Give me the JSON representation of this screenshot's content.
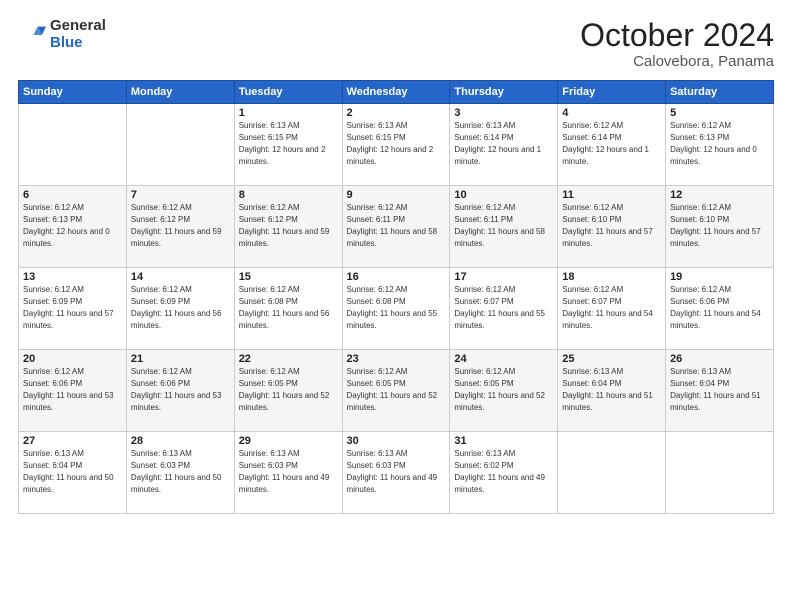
{
  "header": {
    "logo_general": "General",
    "logo_blue": "Blue",
    "month": "October 2024",
    "location": "Calovebora, Panama"
  },
  "weekdays": [
    "Sunday",
    "Monday",
    "Tuesday",
    "Wednesday",
    "Thursday",
    "Friday",
    "Saturday"
  ],
  "weeks": [
    [
      null,
      null,
      {
        "day": 1,
        "sunrise": "6:13 AM",
        "sunset": "6:15 PM",
        "daylight": "12 hours and 2 minutes."
      },
      {
        "day": 2,
        "sunrise": "6:13 AM",
        "sunset": "6:15 PM",
        "daylight": "12 hours and 2 minutes."
      },
      {
        "day": 3,
        "sunrise": "6:13 AM",
        "sunset": "6:14 PM",
        "daylight": "12 hours and 1 minute."
      },
      {
        "day": 4,
        "sunrise": "6:12 AM",
        "sunset": "6:14 PM",
        "daylight": "12 hours and 1 minute."
      },
      {
        "day": 5,
        "sunrise": "6:12 AM",
        "sunset": "6:13 PM",
        "daylight": "12 hours and 0 minutes."
      }
    ],
    [
      {
        "day": 6,
        "sunrise": "6:12 AM",
        "sunset": "6:13 PM",
        "daylight": "12 hours and 0 minutes."
      },
      {
        "day": 7,
        "sunrise": "6:12 AM",
        "sunset": "6:12 PM",
        "daylight": "11 hours and 59 minutes."
      },
      {
        "day": 8,
        "sunrise": "6:12 AM",
        "sunset": "6:12 PM",
        "daylight": "11 hours and 59 minutes."
      },
      {
        "day": 9,
        "sunrise": "6:12 AM",
        "sunset": "6:11 PM",
        "daylight": "11 hours and 58 minutes."
      },
      {
        "day": 10,
        "sunrise": "6:12 AM",
        "sunset": "6:11 PM",
        "daylight": "11 hours and 58 minutes."
      },
      {
        "day": 11,
        "sunrise": "6:12 AM",
        "sunset": "6:10 PM",
        "daylight": "11 hours and 57 minutes."
      },
      {
        "day": 12,
        "sunrise": "6:12 AM",
        "sunset": "6:10 PM",
        "daylight": "11 hours and 57 minutes."
      }
    ],
    [
      {
        "day": 13,
        "sunrise": "6:12 AM",
        "sunset": "6:09 PM",
        "daylight": "11 hours and 57 minutes."
      },
      {
        "day": 14,
        "sunrise": "6:12 AM",
        "sunset": "6:09 PM",
        "daylight": "11 hours and 56 minutes."
      },
      {
        "day": 15,
        "sunrise": "6:12 AM",
        "sunset": "6:08 PM",
        "daylight": "11 hours and 56 minutes."
      },
      {
        "day": 16,
        "sunrise": "6:12 AM",
        "sunset": "6:08 PM",
        "daylight": "11 hours and 55 minutes."
      },
      {
        "day": 17,
        "sunrise": "6:12 AM",
        "sunset": "6:07 PM",
        "daylight": "11 hours and 55 minutes."
      },
      {
        "day": 18,
        "sunrise": "6:12 AM",
        "sunset": "6:07 PM",
        "daylight": "11 hours and 54 minutes."
      },
      {
        "day": 19,
        "sunrise": "6:12 AM",
        "sunset": "6:06 PM",
        "daylight": "11 hours and 54 minutes."
      }
    ],
    [
      {
        "day": 20,
        "sunrise": "6:12 AM",
        "sunset": "6:06 PM",
        "daylight": "11 hours and 53 minutes."
      },
      {
        "day": 21,
        "sunrise": "6:12 AM",
        "sunset": "6:06 PM",
        "daylight": "11 hours and 53 minutes."
      },
      {
        "day": 22,
        "sunrise": "6:12 AM",
        "sunset": "6:05 PM",
        "daylight": "11 hours and 52 minutes."
      },
      {
        "day": 23,
        "sunrise": "6:12 AM",
        "sunset": "6:05 PM",
        "daylight": "11 hours and 52 minutes."
      },
      {
        "day": 24,
        "sunrise": "6:12 AM",
        "sunset": "6:05 PM",
        "daylight": "11 hours and 52 minutes."
      },
      {
        "day": 25,
        "sunrise": "6:13 AM",
        "sunset": "6:04 PM",
        "daylight": "11 hours and 51 minutes."
      },
      {
        "day": 26,
        "sunrise": "6:13 AM",
        "sunset": "6:04 PM",
        "daylight": "11 hours and 51 minutes."
      }
    ],
    [
      {
        "day": 27,
        "sunrise": "6:13 AM",
        "sunset": "6:04 PM",
        "daylight": "11 hours and 50 minutes."
      },
      {
        "day": 28,
        "sunrise": "6:13 AM",
        "sunset": "6:03 PM",
        "daylight": "11 hours and 50 minutes."
      },
      {
        "day": 29,
        "sunrise": "6:13 AM",
        "sunset": "6:03 PM",
        "daylight": "11 hours and 49 minutes."
      },
      {
        "day": 30,
        "sunrise": "6:13 AM",
        "sunset": "6:03 PM",
        "daylight": "11 hours and 49 minutes."
      },
      {
        "day": 31,
        "sunrise": "6:13 AM",
        "sunset": "6:02 PM",
        "daylight": "11 hours and 49 minutes."
      },
      null,
      null
    ]
  ]
}
